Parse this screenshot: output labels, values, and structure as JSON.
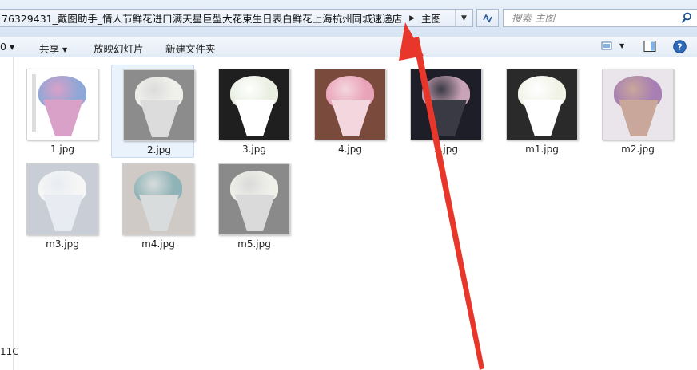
{
  "address": {
    "path": "76329431_戴图助手_情人节鲜花进口满天星巨型大花束生日表白鲜花上海杭州同城速递店",
    "current": "主图"
  },
  "search": {
    "placeholder": "搜索 主图"
  },
  "toolbar": {
    "partial_left": "0",
    "share": "共享",
    "slideshow": "放映幻灯片",
    "new_folder": "新建文件夹"
  },
  "navpane": {
    "partial_text": "11C"
  },
  "files": [
    {
      "name": "1.jpg",
      "bg": "#ffffff",
      "bouquet": "#8fa7d6",
      "accent": "#d9a0c8"
    },
    {
      "name": "2.jpg",
      "bg": "#8c8c8c",
      "bouquet": "#f1f1ec",
      "accent": "#dcdcdc"
    },
    {
      "name": "3.jpg",
      "bg": "#1f1f1f",
      "bouquet": "#e8eee0",
      "accent": "#ffffff"
    },
    {
      "name": "4.jpg",
      "bg": "#7a4a3c",
      "bouquet": "#e9a3b8",
      "accent": "#f4d6df"
    },
    {
      "name": "5.jpg",
      "bg": "#1e1e28",
      "bouquet": "#c9a3b8",
      "accent": "#3a3a44"
    },
    {
      "name": "m1.jpg",
      "bg": "#2a2a2a",
      "bouquet": "#f0f2e6",
      "accent": "#ffffff"
    },
    {
      "name": "m2.jpg",
      "bg": "#e9e5ea",
      "bouquet": "#a77fb4",
      "accent": "#c9a79a"
    },
    {
      "name": "m3.jpg",
      "bg": "#c9ced6",
      "bouquet": "#f6f6f6",
      "accent": "#e8ecf2"
    },
    {
      "name": "m4.jpg",
      "bg": "#cfcac6",
      "bouquet": "#8fb3b6",
      "accent": "#d8dcdc"
    },
    {
      "name": "m5.jpg",
      "bg": "#8a8a8a",
      "bouquet": "#f0f0ea",
      "accent": "#dadada"
    }
  ],
  "colors": {
    "annotation_arrow": "#e8362b",
    "selection": "#eaf3fc"
  }
}
